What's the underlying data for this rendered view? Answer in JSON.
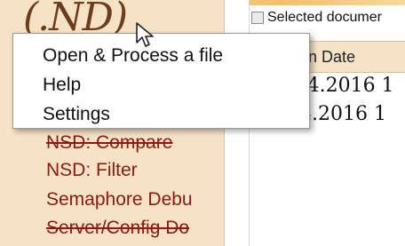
{
  "app": {
    "logo_text": "(.ND)"
  },
  "sidebar": {
    "items": [
      {
        "label": "NSD: Compare"
      },
      {
        "label": "NSD: Filter"
      },
      {
        "label": "Semaphore Debu"
      },
      {
        "label": "Server/Config Do"
      }
    ]
  },
  "content": {
    "toolbar": {
      "selected_label": "Selected documer"
    },
    "table": {
      "column_header": "ion Date",
      "rows": [
        {
          "date": ")4.2016 1"
        },
        {
          "date": "4.2016 1"
        }
      ]
    }
  },
  "context_menu": {
    "items": [
      {
        "label": "Open & Process a file"
      },
      {
        "label": "Help"
      },
      {
        "label": "Settings"
      }
    ]
  },
  "colors": {
    "sidebar_bg": "#f6e3c6",
    "sidebar_text": "#8a1a12",
    "logo": "#6b3d1c"
  }
}
